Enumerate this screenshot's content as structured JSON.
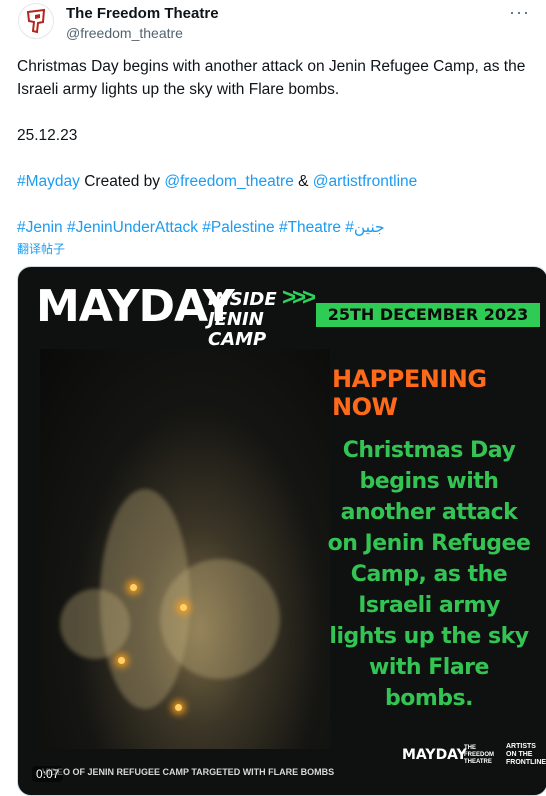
{
  "author": {
    "name": "The Freedom Theatre",
    "handle": "@freedom_theatre"
  },
  "tweet": {
    "line1": "Christmas Day begins with another attack on Jenin Refugee Camp, as the Israeli army lights up the sky with Flare bombs.",
    "date": "25.12.23",
    "mayday_tag": "#Mayday",
    "created_by": " Created by ",
    "mention1": "@freedom_theatre",
    "amp": " & ",
    "mention2": "@artistfrontline",
    "tags": "#Jenin #JeninUnderAttack #Palestine #Theatre #جنين",
    "translate": "翻译帖子"
  },
  "media": {
    "may": "MAY",
    "day": "DAY",
    "inside": "INSIDE",
    "jenin_camp": "JENIN CAMP",
    "date_banner": "25TH DECEMBER 2023",
    "happening": "HAPPENING NOW",
    "headline": "Christmas Day begins with another attack on Jenin Refugee Camp, as the Israeli army lights up the sky with Flare bombs.",
    "caption": "VIDEO OF JENIN REFUGEE CAMP TARGETED WITH FLARE BOMBS",
    "timestamp": "0:07",
    "logo_mayday": "MAYDAY",
    "logo_freedom": "THE FREEDOM THEATRE",
    "logo_artists": "ARTISTS ON THE FRONTLINE"
  },
  "colors": {
    "link": "#1d9bf0",
    "accent_green": "#2ecc54",
    "accent_orange": "#ff6a1a"
  }
}
